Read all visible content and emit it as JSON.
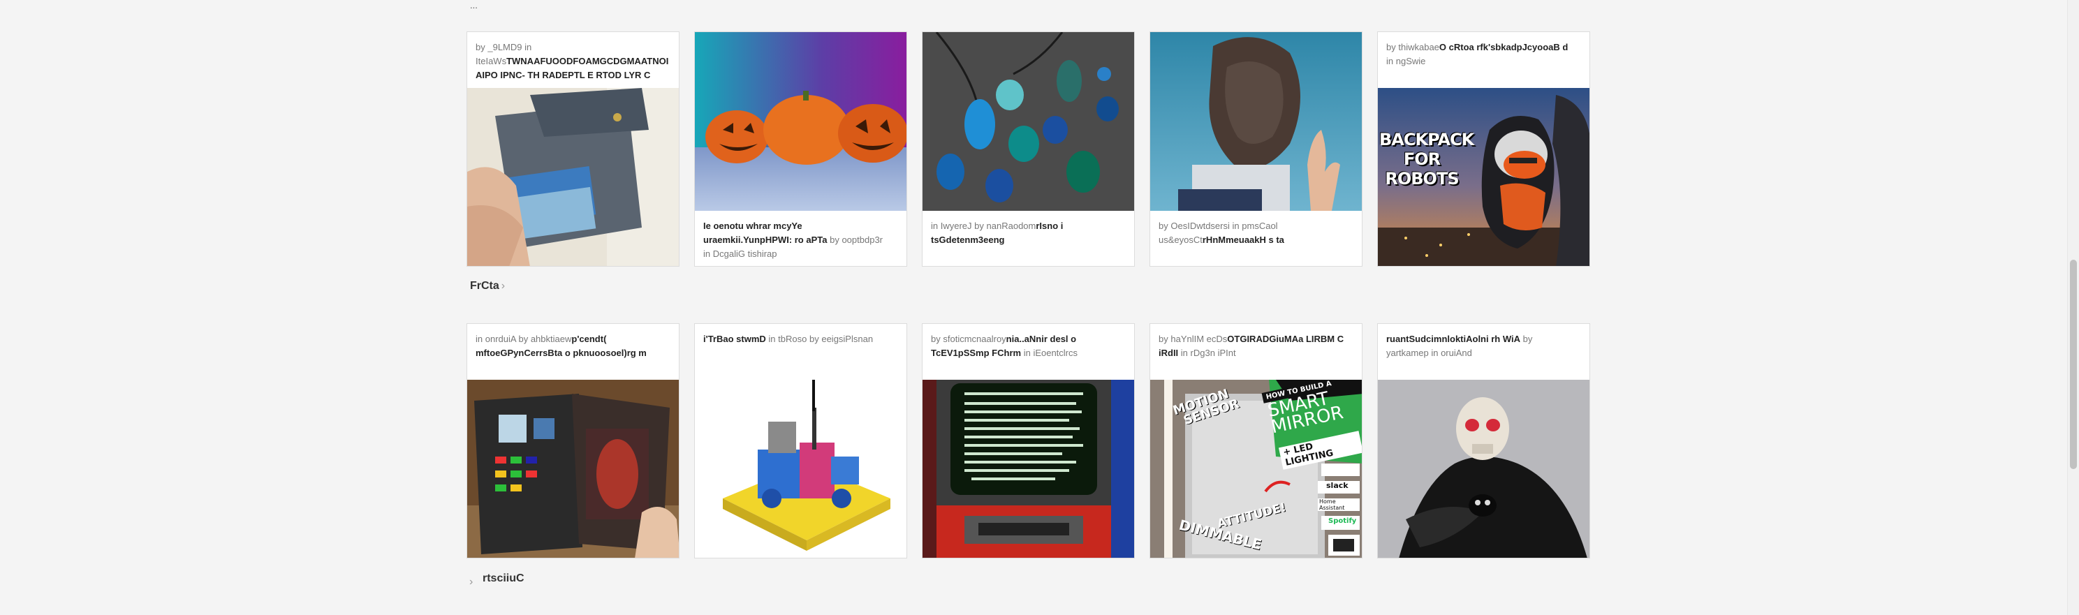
{
  "top_stub": "...",
  "section1": {
    "label": "FrCta",
    "chevron": "›"
  },
  "section2": {
    "label": "rtsciiuC",
    "chevron": "›"
  },
  "row1": [
    {
      "by": "by",
      "author": "_9LMD9",
      "in": "in",
      "category": "IteIaWs",
      "title_a": "TWNAAFUOODFOAMGCDGMAATNOI",
      "title_b": "AIPO IPNC- TH RADEPTL E RTOD LYR C",
      "image": "wallet-photo"
    },
    {
      "title_a": "Ie oenotu whrar mcyYe",
      "title_b": "uraemkii.YunpHPWI: ro aPTa",
      "by": "by",
      "author": "ooptbdp3r",
      "in": "in",
      "category": "DcgaliG tishirap",
      "image": "pumpkins-photo"
    },
    {
      "in": "in",
      "category": "IwyereJ",
      "by": "by",
      "author": "nanRaodom",
      "title_a": "rIsno i",
      "title_b": "tsGdetenm3eeng",
      "image": "stones-photo"
    },
    {
      "by": "by",
      "author": "OesIDwtdsersi",
      "in": "in",
      "category": "pmsCaol",
      "title_a": "us&eyosCt",
      "title_b": "rHnMmeuaakH s ta",
      "image": "mask-photo"
    },
    {
      "by": "by",
      "author": "thiwkabae",
      "title_a": "O cRtoa rfk'sbkadpJcyooaB d",
      "in": "in",
      "category": "ngSwie",
      "image": "backpack-photo",
      "image_text": [
        "BACKPACK",
        "FOR",
        "ROBOTS"
      ]
    }
  ],
  "row2": [
    {
      "in": "in",
      "category": "onrduiA",
      "by": "by",
      "author": "ahbktiaew",
      "title_a": "p'cendt(",
      "title_b": "mftoeGPynCerrsBta o pknuoosoel)rg m",
      "image": "book-device-photo"
    },
    {
      "title_a": "i'TrBao stwmD",
      "in": "in",
      "category": "tbRoso",
      "by": "by",
      "author": "eeigsiPlsnan",
      "image": "robot-model-photo"
    },
    {
      "by": "by",
      "author": "sfoticmcnaalroy",
      "title_a": "nia..aNnir desl o",
      "title_b": "TcEV1pSSmp FChrm",
      "in": "in",
      "category": "iEoentclrcs",
      "image": "zelda-crt-photo"
    },
    {
      "by": "by",
      "author": "haYnlIM ecDs",
      "title_a": "OTGIRADGiuMAa LIRBM C",
      "title_b": "iRdII",
      "in": "in",
      "category": "rDg3n iPInt",
      "image": "smart-mirror-photo",
      "image_text": [
        "MOTION",
        "SENSOR",
        "HOW TO BUILD A",
        "SMART",
        "MIRROR",
        "+ LED LIGHTING",
        "ATTITUDE!",
        "DIMMABLE",
        "slack",
        "Home Assistant",
        "Spotify"
      ]
    },
    {
      "title_a": "ruantSudcimnloktiAolni rh WiA",
      "by": "by",
      "author": "yartkamep",
      "in": "in",
      "category": "oruiAnd",
      "image": "skull-figure-photo"
    }
  ]
}
